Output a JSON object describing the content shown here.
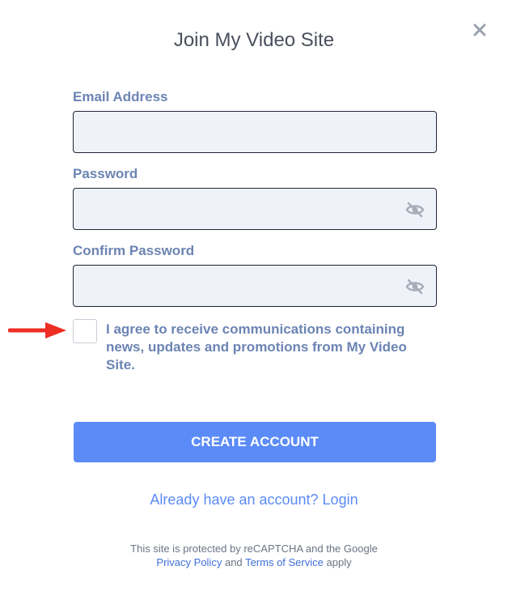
{
  "modal": {
    "title": "Join My Video Site",
    "close_icon": "close-x-icon"
  },
  "form": {
    "email": {
      "label": "Email Address",
      "value": "",
      "placeholder": ""
    },
    "password": {
      "label": "Password",
      "value": "",
      "placeholder": "",
      "toggle_icon": "eye-slash-icon"
    },
    "confirm_password": {
      "label": "Confirm Password",
      "value": "",
      "placeholder": "",
      "toggle_icon": "eye-slash-icon"
    },
    "agree_checkbox": {
      "checked": false,
      "label": "I agree to receive communications containing news, updates and promotions from My Video Site."
    },
    "submit_label": "CREATE ACCOUNT"
  },
  "login_prompt": "Already have an account? Login",
  "recaptcha": {
    "line1": "This site is protected by reCAPTCHA and the Google",
    "privacy_link": "Privacy Policy",
    "and_text": "and",
    "terms_link": "Terms of Service",
    "apply_text": "apply"
  },
  "annotation": {
    "arrow_icon": "red-arrow-icon"
  },
  "colors": {
    "accent": "#5b8bf7",
    "label": "#6c84b3",
    "input_bg": "#eff3f9",
    "arrow": "#ee2d24"
  }
}
